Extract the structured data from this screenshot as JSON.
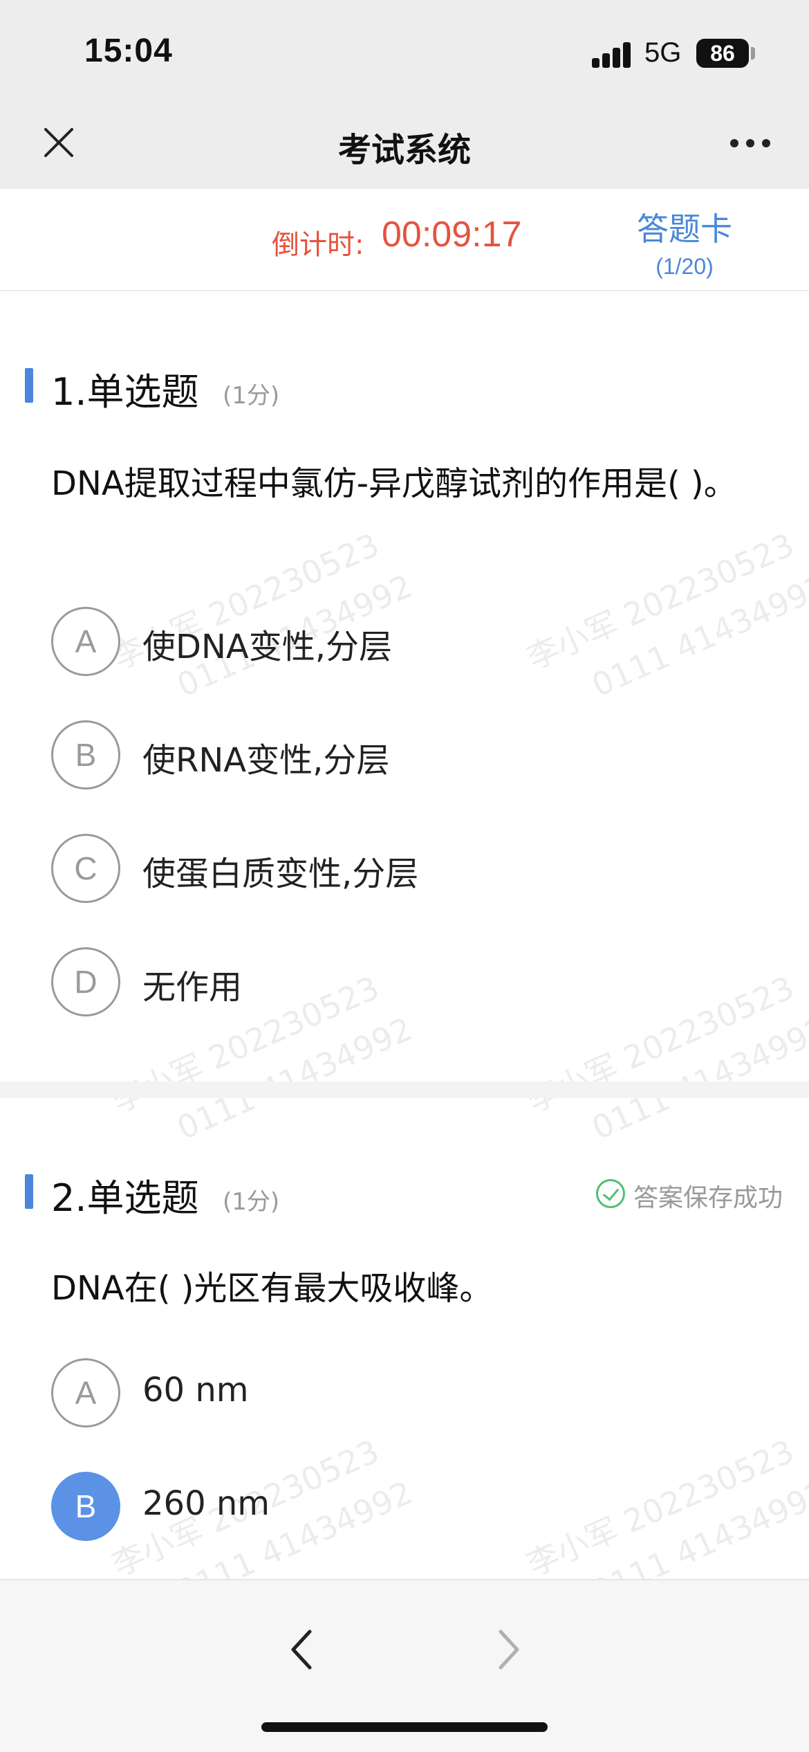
{
  "status_bar": {
    "time": "15:04",
    "network": "5G",
    "battery": "86"
  },
  "nav": {
    "title": "考试系统",
    "close_icon": "close-icon",
    "more_icon": "more-icon"
  },
  "timer": {
    "label": "倒计时:",
    "value": "00:09:17"
  },
  "answer_card": {
    "label": "答题卡",
    "count": "(1/20)"
  },
  "watermark": {
    "line1": "李小军 202230523",
    "line2": "0111 41434992"
  },
  "questions": [
    {
      "title": "1.单选题",
      "score": "(1分)",
      "stem": "DNA提取过程中氯仿-异戊醇试剂的作用是(     )。",
      "options": [
        {
          "letter": "A",
          "text": "使DNA变性,分层",
          "selected": false
        },
        {
          "letter": "B",
          "text": "使RNA变性,分层",
          "selected": false
        },
        {
          "letter": "C",
          "text": "使蛋白质变性,分层",
          "selected": false
        },
        {
          "letter": "D",
          "text": "无作用",
          "selected": false
        }
      ]
    },
    {
      "title": "2.单选题",
      "score": "(1分)",
      "status": "答案保存成功",
      "stem": "DNA在(     )光区有最大吸收峰。",
      "options": [
        {
          "letter": "A",
          "text": "60 nm",
          "selected": false
        },
        {
          "letter": "B",
          "text": "260 nm",
          "selected": true
        }
      ]
    }
  ],
  "bottom_nav": {
    "prev_icon": "chevron-left-icon",
    "next_icon": "chevron-right-icon"
  },
  "colors": {
    "accent": "#4a86d9",
    "timer": "#e5533f",
    "selected": "#5b92e5",
    "success": "#4fbf74"
  }
}
